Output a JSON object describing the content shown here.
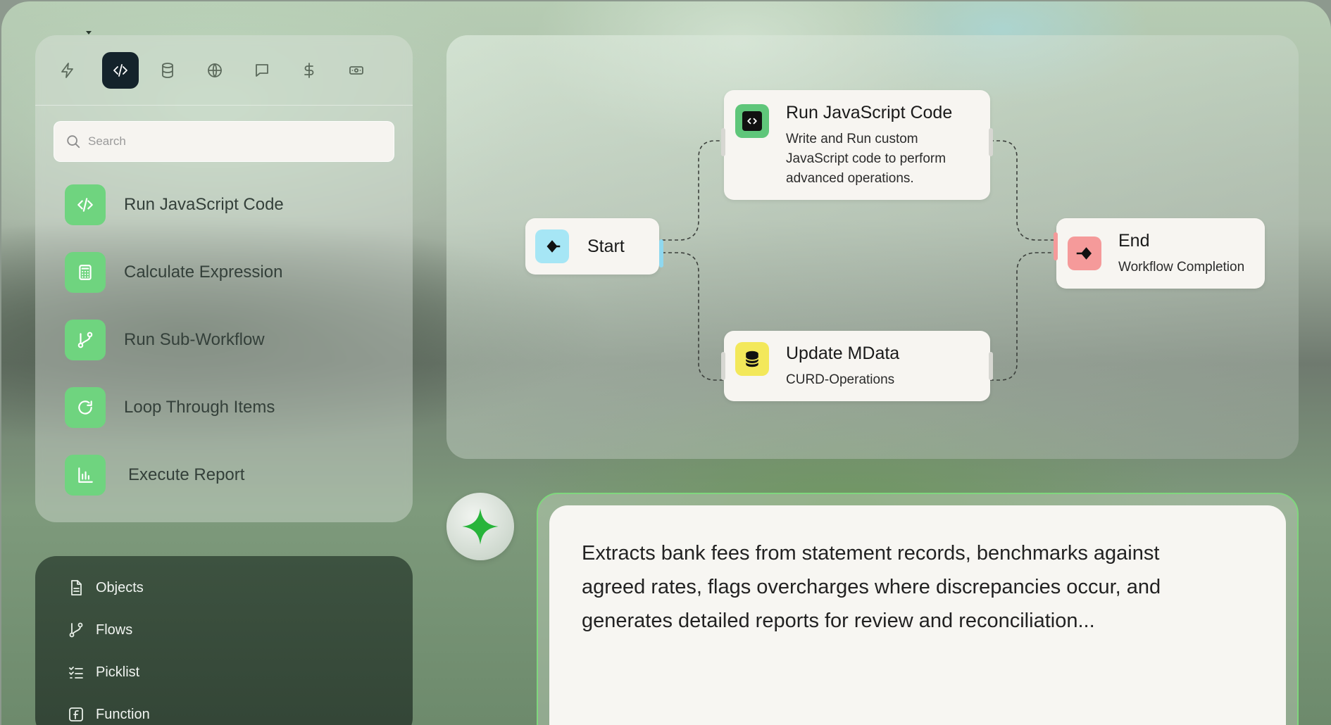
{
  "toolbar": {
    "tools": [
      "lightning-icon",
      "code-icon",
      "database-icon",
      "globe-icon",
      "chat-icon",
      "dollar-icon",
      "money-icon"
    ],
    "active": "code-icon"
  },
  "search": {
    "placeholder": "Search"
  },
  "palette_items": [
    {
      "label": "Run JavaScript Code",
      "icon": "code-icon"
    },
    {
      "label": "Calculate Expression",
      "icon": "calculator-icon"
    },
    {
      "label": "Run Sub-Workflow",
      "icon": "branch-icon"
    },
    {
      "label": "Loop Through Items",
      "icon": "refresh-icon"
    },
    {
      "label": "Execute Report",
      "icon": "bar-chart-icon"
    }
  ],
  "objects_menu": [
    {
      "label": "Objects",
      "icon": "document-icon"
    },
    {
      "label": "Flows",
      "icon": "branch-icon"
    },
    {
      "label": "Picklist",
      "icon": "checklist-icon"
    },
    {
      "label": "Function",
      "icon": "function-icon"
    }
  ],
  "workflow": {
    "start": {
      "title": "Start"
    },
    "js_node": {
      "title": "Run JavaScript Code",
      "desc_line1": "Write and Run custom",
      "desc_line2": "JavaScript code to perform",
      "desc_line3": "advanced operations."
    },
    "mdata_node": {
      "title": "Update MData",
      "desc": "CURD-Operations"
    },
    "end": {
      "title": "End",
      "desc": "Workflow Completion"
    }
  },
  "prompt": {
    "text": "Extracts bank fees from statement records, benchmarks against agreed rates, flags overcharges where discrepancies occur, and generates detailed reports for review and reconciliation..."
  },
  "colors": {
    "accent_green": "#6fd47f",
    "start_icon": "#a6e6f5",
    "js_icon": "#5fc67a",
    "mdata_icon": "#f3e85a",
    "end_icon": "#f59a9a",
    "active_tool": "#14232b"
  }
}
